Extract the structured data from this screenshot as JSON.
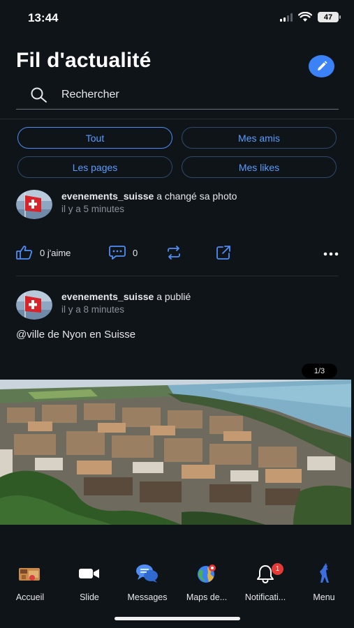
{
  "status_bar": {
    "time": "13:44",
    "battery": "47"
  },
  "header": {
    "title": "Fil d'actualité"
  },
  "search": {
    "placeholder": "Rechercher"
  },
  "filters": [
    {
      "label": "Tout",
      "active": true
    },
    {
      "label": "Mes amis",
      "active": false
    },
    {
      "label": "Les pages",
      "active": false
    },
    {
      "label": "Mes likes",
      "active": false
    }
  ],
  "posts": [
    {
      "author": "evenements_suisse",
      "action": "a changé sa photo",
      "time": "il y a 5 minutes",
      "likes_label": "0 j'aime",
      "comments": "0"
    },
    {
      "author": "evenements_suisse",
      "action": "a publié",
      "time": "il y a 8 minutes",
      "text": "@ville de Nyon en Suisse",
      "image_counter": "1/3"
    }
  ],
  "tabbar": [
    {
      "label": "Accueil",
      "icon": "home-icon"
    },
    {
      "label": "Slide",
      "icon": "video-camera-icon"
    },
    {
      "label": "Messages",
      "icon": "chat-bubbles-icon"
    },
    {
      "label": "Maps de...",
      "icon": "globe-map-icon"
    },
    {
      "label": "Notificati...",
      "icon": "bell-icon",
      "badge": "1"
    },
    {
      "label": "Menu",
      "icon": "menu-figure-icon"
    }
  ],
  "colors": {
    "accent": "#3b82f6",
    "link_blue": "#5b9cff",
    "badge": "#e53935",
    "background": "#0f1419"
  }
}
